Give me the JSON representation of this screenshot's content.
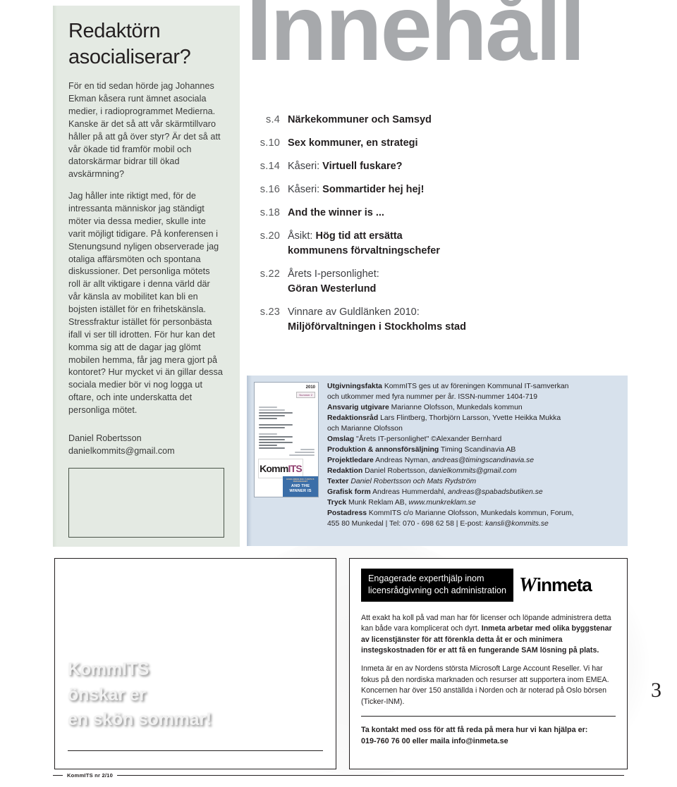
{
  "editorial": {
    "title_line1": "Redaktörn",
    "title_line2": "asocialiserar?",
    "paragraph1": "För en tid sedan hörde jag Johannes Ekman kåsera runt ämnet asociala medier, i radioprogrammet Medierna. Kanske är det så att vår skärmtillvaro håller på att gå över styr? Är det så att vår ökade tid framför mobil och datorskärmar bidrar till ökad avskärmning?",
    "paragraph2": "Jag håller inte riktigt med, för de intressanta människor jag ständigt möter via dessa medier, skulle inte varit möjligt tidigare. På konferensen i Stenungsund nyligen observerade jag otaliga affärsmöten och spontana diskussioner. Det personliga mötets roll är allt viktigare i denna värld där vår känsla av mobilitet kan bli en bojsten istället för en frihetskänsla. Stressfraktur istället för personbästa ifall vi ser till idrotten. För hur kan det komma sig att de dagar jag glömt mobilen hemma, får jag mera gjort på kontoret? Hur mycket vi än gillar dessa sociala medier bör vi nog logga ut oftare, och inte underskatta det personliga mötet.",
    "signature_name": "Daniel Robertsson",
    "signature_email": "danielkommits@gmail.com"
  },
  "toc": {
    "heading": "Innehåll",
    "items": [
      {
        "page": "s.4",
        "lead": "",
        "bold": "Närkekommuner och Samsyd",
        "bold2": ""
      },
      {
        "page": "s.10",
        "lead": "",
        "bold": "Sex kommuner, en strategi",
        "bold2": ""
      },
      {
        "page": "s.14",
        "lead": "Kåseri: ",
        "bold": "Virtuell fuskare?",
        "bold2": ""
      },
      {
        "page": "s.16",
        "lead": "Kåseri: ",
        "bold": "Sommartider hej hej!",
        "bold2": ""
      },
      {
        "page": "s.18",
        "lead": "",
        "bold": "And the winner is ...",
        "bold2": ""
      },
      {
        "page": "s.20",
        "lead": "Åsikt: ",
        "bold": "Hög tid att ersätta",
        "bold2": "kommunens förvaltningschefer"
      },
      {
        "page": "s.22",
        "lead": "Årets I-personlighet:",
        "bold": "",
        "bold2": "Göran Westerlund"
      },
      {
        "page": "s.23",
        "lead": "Vinnare av Guldlänken 2010:",
        "bold": "",
        "bold2": "Miljöförvaltningen i Stockholms stad"
      }
    ]
  },
  "cover_thumb": {
    "year": "2010",
    "issue": "Nummer 2",
    "logo_komm": "Komm",
    "logo_its": "ITS",
    "badge_small": "GULDLÄNKEN 2010 / Å RETS IT-PERSONLIGHET",
    "badge_line1": "AND THE",
    "badge_line2": "WINNER IS"
  },
  "imprint": {
    "lines": [
      {
        "label": "Utgivningsfakta",
        "text": " KommITS ges ut av föreningen Kommunal IT-samverkan"
      },
      {
        "label": "",
        "text": "och utkommer med fyra nummer per år. ISSN-nummer 1404-719"
      },
      {
        "label": "Ansvarig utgivare",
        "text": " Marianne Olofsson, Munkedals kommun"
      },
      {
        "label": "Redaktionsråd",
        "text": " Lars Flintberg, Thorbjörn Larsson, Yvette Heikka Mukka"
      },
      {
        "label": "",
        "text": "och Marianne Olofsson"
      },
      {
        "label": "Omslag",
        "text": " \"Årets IT-personlighet\" ©Alexander Bernhard"
      },
      {
        "label": "Produktion & annonsförsäljning",
        "text": " Timing Scandinavia AB"
      },
      {
        "label": "Projektledare",
        "text": " Andreas Nyman, ",
        "italic": "andreas@timingscandinavia.se"
      },
      {
        "label": "Redaktion",
        "text": " Daniel Robertsson, ",
        "italic": "danielkommits@gmail.com"
      },
      {
        "label": "Texter",
        "text": " ",
        "italic": "Daniel Robertsson och Mats Rydström"
      },
      {
        "label": "Grafisk form",
        "text": " Andreas Hummerdahl, ",
        "italic": "andreas@spabadsbutiken.se"
      },
      {
        "label": "Tryck",
        "text": " Munk Reklam AB, ",
        "italic": "www.munkreklam.se"
      },
      {
        "label": "Postadress",
        "text": " KommITS c/o Marianne Olofsson, Munkedals kommun, Forum,"
      },
      {
        "label": "",
        "text": "455 80 Munkedal | Tel: 070 - 698 62 58 | E-post: ",
        "italic": "kansli@kommits.se"
      }
    ]
  },
  "ad_left": {
    "line1": "KommITS",
    "line2": "önskar er",
    "line3": "en skön sommar!"
  },
  "ad_right": {
    "band_line1": "Engagerade experthjälp inom",
    "band_line2": "licensrådgivning och administration",
    "logo_mark": "W",
    "logo_text": "inmeta",
    "body1_normal": "Att exakt ha koll på vad man har för licenser och löpande administrera detta kan både vara komplicerat och dyrt. ",
    "body1_bold": "Inmeta arbetar med olika byggstenar av licenstjänster för att förenkla detta åt er och minimera instegskostnaden för er att få en fungerande SAM lösning på plats.",
    "body2": "Inmeta är en av Nordens största Microsoft Large Account Reseller. Vi har fokus på den nordiska marknaden och resurser att supportera inom EMEA. Koncernen har över 150 anställda i Norden och är noterad på Oslo börsen (Ticker-INM).",
    "cta_line1": "Ta kontakt med oss för att få reda på mera hur vi kan hjälpa er:",
    "cta_line2": "019-760 76 00 eller maila info@inmeta.se"
  },
  "page_number": "3",
  "footer_text": "KommITS nr 2/10",
  "colors": {
    "editorial_bg": "#e4eae3",
    "imprint_bg": "#d7e1ec",
    "toc_heading": "#a7a9ac",
    "ink": "#231f20"
  }
}
